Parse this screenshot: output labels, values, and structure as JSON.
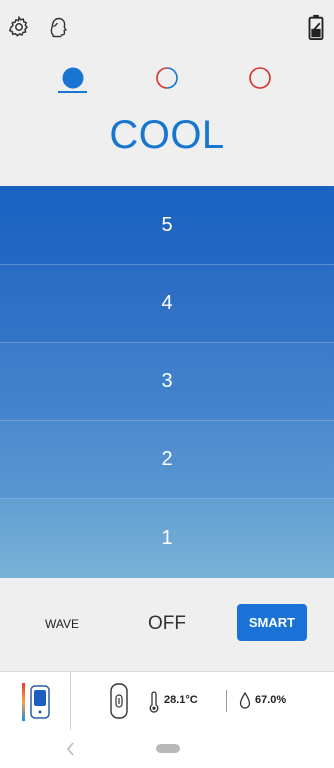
{
  "header": {
    "icons": [
      "gear-icon",
      "user-icon",
      "battery-icon"
    ]
  },
  "mode_tabs": {
    "items": [
      {
        "name": "cool",
        "icon": "filled-circle-icon",
        "selected": true
      },
      {
        "name": "auto",
        "icon": "dual-circle-icon",
        "selected": false
      },
      {
        "name": "heat",
        "icon": "ring-icon",
        "selected": false
      }
    ]
  },
  "mode": {
    "title": "COOL"
  },
  "levels": [
    "5",
    "4",
    "3",
    "2",
    "1"
  ],
  "controls": {
    "wave_label": "WAVE",
    "off_label": "OFF",
    "smart_label": "SMART"
  },
  "status": {
    "temperature": "28.1°C",
    "humidity": "67.0%"
  },
  "colors": {
    "accent": "#1875d2",
    "heat": "#d6312b"
  }
}
